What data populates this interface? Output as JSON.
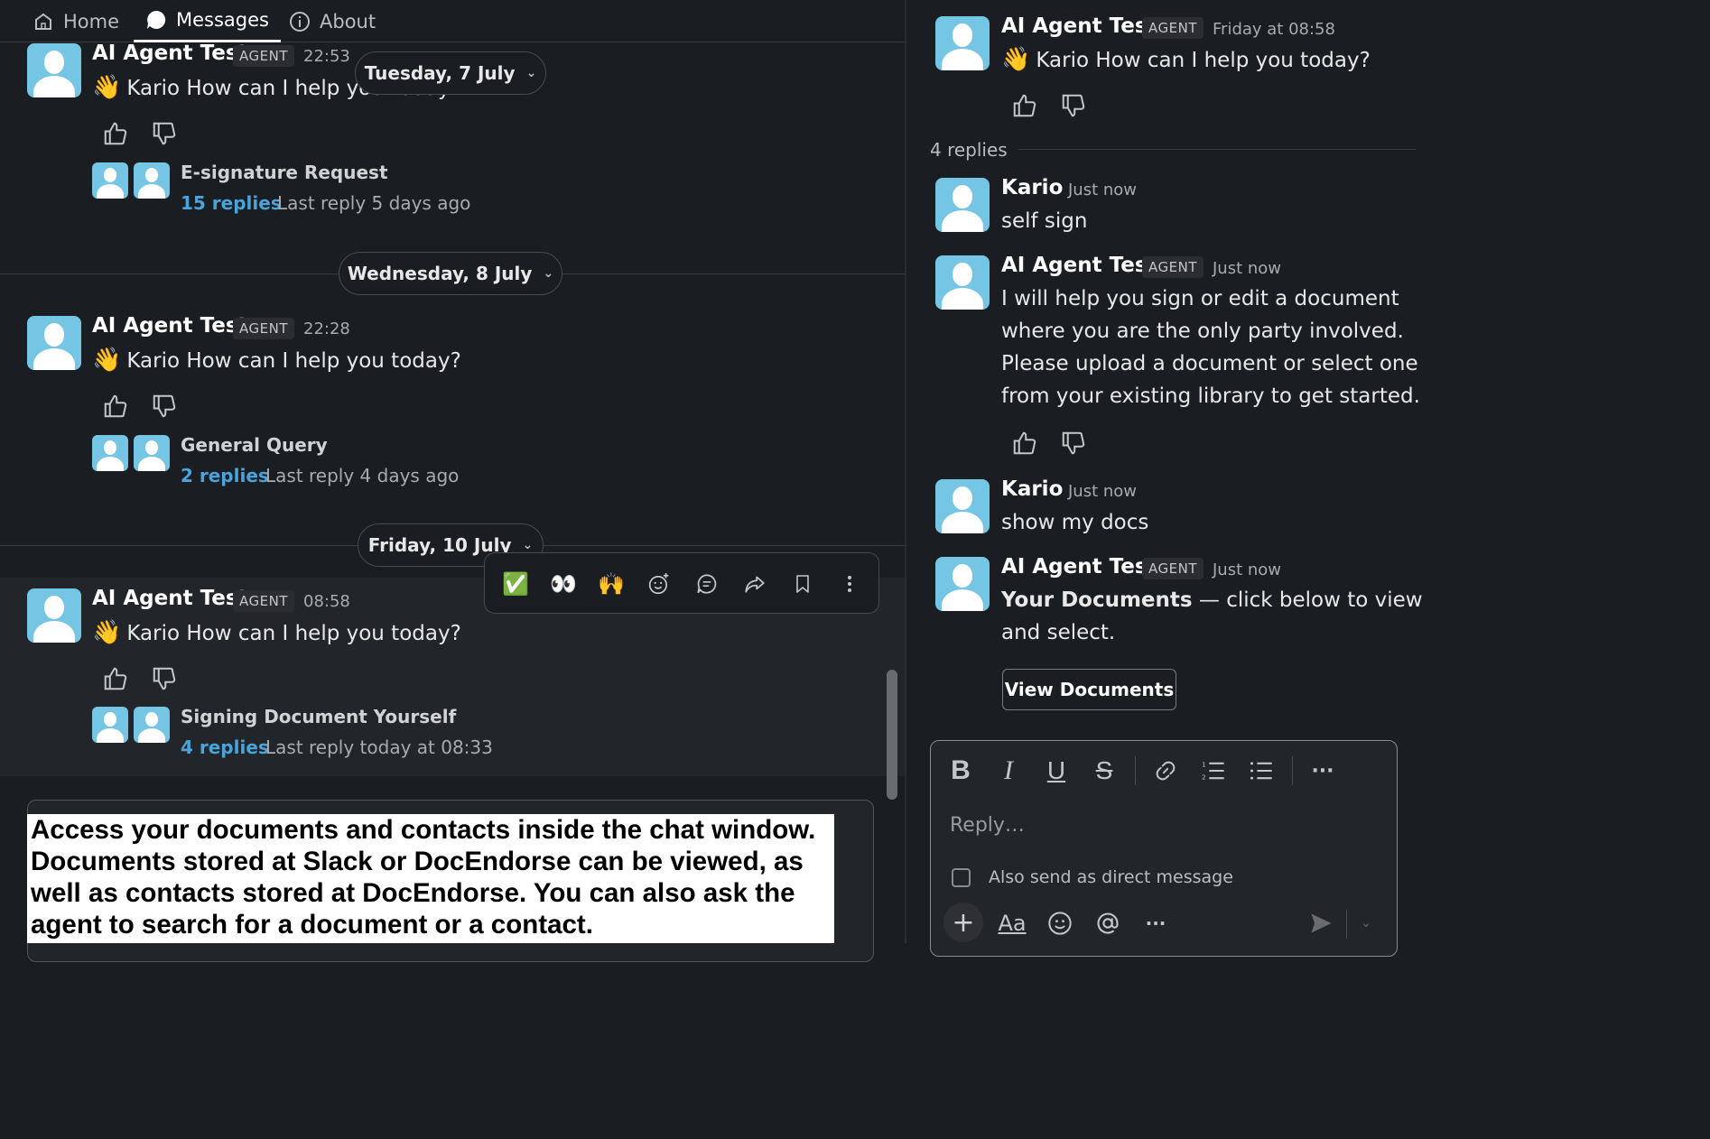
{
  "nav": {
    "tabs": [
      {
        "label": "Home",
        "icon": "home-icon"
      },
      {
        "label": "Messages",
        "icon": "chat-bubble-icon"
      },
      {
        "label": "About",
        "icon": "info-icon"
      }
    ],
    "active": "Messages"
  },
  "channel": {
    "days": [
      {
        "date": "Tuesday, 7 July",
        "message": {
          "sender": "AI Agent Test",
          "badge": "AGENT",
          "time": "22:53",
          "emoji": "👋",
          "text": "Kario How can I help you today?"
        },
        "thread": {
          "title": "E-signature Request",
          "replies": "15 replies",
          "last_reply": "Last reply 5 days ago"
        }
      },
      {
        "date": "Wednesday, 8 July",
        "message": {
          "sender": "AI Agent Test",
          "badge": "AGENT",
          "time": "22:28",
          "emoji": "👋",
          "text": "Kario How can I help you today?"
        },
        "thread": {
          "title": "General Query",
          "replies": "2 replies",
          "last_reply": "Last reply 4 days ago"
        }
      },
      {
        "date": "Friday, 10 July",
        "message": {
          "sender": "AI Agent Test",
          "badge": "AGENT",
          "time": "08:58",
          "emoji": "👋",
          "text": "Kario How can I help you today?"
        },
        "thread": {
          "title": "Signing Document Yourself",
          "replies": "4 replies",
          "last_reply": "Last reply today at 08:33"
        }
      }
    ],
    "hover_actions": {
      "reactions": [
        "✅",
        "👀",
        "🙌"
      ],
      "icons": [
        "add-reaction-icon",
        "reply-in-thread-icon",
        "share-icon",
        "bookmark-icon",
        "more-icon"
      ]
    },
    "callout": "Access your documents and contacts inside the chat window. Documents stored at Slack or DocEndorse can be viewed, as well as contacts stored at DocEndorse. You can also ask the agent to search for a document or a contact."
  },
  "thread_panel": {
    "root": {
      "sender": "AI Agent Test",
      "badge": "AGENT",
      "time": "Friday at 08:58",
      "emoji": "👋",
      "text": "Kario How can I help you today?"
    },
    "replies_count": "4 replies",
    "replies": [
      {
        "sender": "Kario",
        "time": "Just now",
        "lines": [
          "self sign"
        ]
      },
      {
        "sender": "AI Agent Test",
        "badge": "AGENT",
        "time": "Just now",
        "lines": [
          "I will help you sign or edit a document",
          "where you are the only party involved.",
          "Please upload a document or select one",
          "from your existing library to get started."
        ]
      },
      {
        "sender": "Kario",
        "time": "Just now",
        "lines": [
          "show my docs"
        ]
      },
      {
        "sender": "AI Agent Test",
        "badge": "AGENT",
        "time": "Just now",
        "bold_lead": "Your Documents",
        "rest": " — click below to view",
        "line2": "and select."
      }
    ],
    "view_button": "View Documents",
    "composer": {
      "placeholder": "Reply…",
      "also_send": "Also send as direct message",
      "format_labels": {
        "bold": "B",
        "italic": "I",
        "underline": "U",
        "strike": "S",
        "more": "···"
      },
      "bottom_labels": {
        "text_format": "Aa",
        "more": "···"
      }
    }
  },
  "colors": {
    "background": "#1a1d21",
    "link": "#4aa4d9",
    "avatar": "#74c6e4"
  }
}
